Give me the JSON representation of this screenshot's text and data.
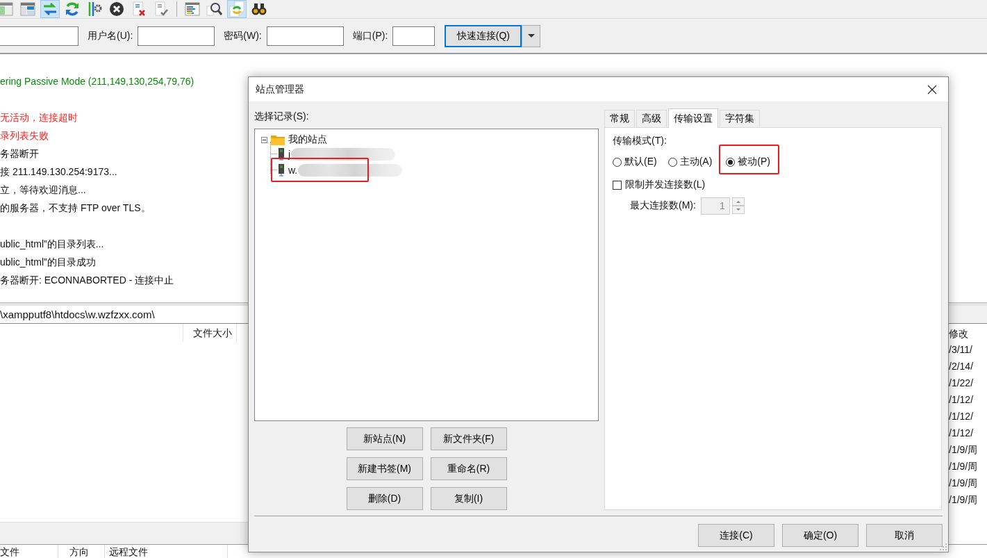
{
  "toolbar": {
    "groups": [
      [
        {
          "kind": "site-manager",
          "selected": false
        },
        {
          "kind": "layout",
          "selected": false
        },
        {
          "kind": "sync",
          "selected": true
        },
        {
          "kind": "refresh",
          "selected": false
        },
        {
          "kind": "process",
          "selected": false
        },
        {
          "kind": "cancel",
          "selected": false
        },
        {
          "kind": "disconnect",
          "selected": false
        },
        {
          "kind": "reconnect",
          "selected": false
        }
      ],
      [
        {
          "kind": "filter",
          "selected": false
        },
        {
          "kind": "search",
          "selected": false
        },
        {
          "kind": "compare",
          "selected": true
        },
        {
          "kind": "find",
          "selected": false
        }
      ]
    ]
  },
  "quickconnect": {
    "username_label": "用户名(U):",
    "password_label": "密码(W):",
    "port_label": "端口(P):",
    "button": "快速连接(Q)"
  },
  "log": [
    {
      "text": "ering Passive Mode (211,149,130,254,79,76)",
      "kind": "response"
    },
    {
      "kind": "blank"
    },
    {
      "text": "无活动，连接超时",
      "kind": "error"
    },
    {
      "text": "录列表失败",
      "kind": "error"
    },
    {
      "text": "务器断开",
      "kind": "status"
    },
    {
      "text": "接 211.149.130.254:9173...",
      "kind": "status"
    },
    {
      "text": "立，等待欢迎消息...",
      "kind": "status"
    },
    {
      "text": "的服务器，不支持 FTP over TLS。",
      "kind": "status"
    },
    {
      "kind": "blank"
    },
    {
      "text": "ublic_html”的目录列表...",
      "kind": "status"
    },
    {
      "text": "ublic_html”的目录成功",
      "kind": "status"
    },
    {
      "text": "务器断开: ECONNABORTED - 连接中止",
      "kind": "status"
    }
  ],
  "local": {
    "path": "\\xampputf8\\htdocs\\w.wzfzxx.com\\",
    "columns": [
      "文件大小"
    ]
  },
  "remote": {
    "columns": [
      "修改"
    ],
    "rows": [
      "/3/11/",
      "/2/14/",
      "/1/22/",
      "/1/12/",
      "/1/12/",
      "/1/12/",
      "/1/9/周",
      "/1/9/周",
      "/1/9/周",
      "/1/9/周"
    ]
  },
  "queue": {
    "columns": [
      "文件",
      "方向",
      "远程文件"
    ]
  },
  "dialog": {
    "title": "站点管理器",
    "tree_label": "选择记录(S):",
    "tree": [
      {
        "label": "我的站点",
        "kind": "folder",
        "expanded": true,
        "redacted": false,
        "annotated": false,
        "children": [
          {
            "label": "j",
            "kind": "site",
            "redacted": true,
            "annotated": false
          },
          {
            "label": "w.",
            "kind": "site",
            "redacted": true,
            "annotated": true
          }
        ]
      }
    ],
    "tree_buttons": [
      "新站点(N)",
      "新文件夹(F)",
      "新建书签(M)",
      "重命名(R)",
      "删除(D)",
      "复制(I)"
    ],
    "tabs": [
      {
        "label": "常规",
        "selected": false
      },
      {
        "label": "高级",
        "selected": false
      },
      {
        "label": "传输设置",
        "selected": true
      },
      {
        "label": "字符集",
        "selected": false
      }
    ],
    "transfer_mode_label": "传输模式(T):",
    "modes": [
      {
        "label": "默认(E)",
        "selected": false,
        "annotated": false
      },
      {
        "label": "主动(A)",
        "selected": false,
        "annotated": false
      },
      {
        "label": "被动(P)",
        "selected": true,
        "annotated": true
      }
    ],
    "limit": {
      "label": "限制并发连接数(L)",
      "checked": false
    },
    "max_connections": {
      "label": "最大连接数(M):",
      "value": "1",
      "disabled": true
    },
    "buttons": [
      "连接(C)",
      "确定(O)",
      "取消"
    ]
  }
}
